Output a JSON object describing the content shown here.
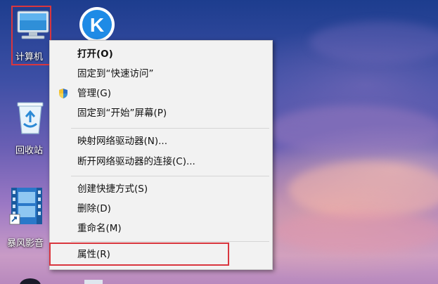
{
  "desktop": {
    "icons": [
      {
        "name": "computer",
        "label": "计算机",
        "icon": "computer-monitor-icon"
      },
      {
        "name": "kugou",
        "label": "",
        "icon": "kugou-k-icon"
      },
      {
        "name": "recycle-bin",
        "label": "回收站",
        "icon": "recycle-bin-icon"
      },
      {
        "name": "baofeng",
        "label": "暴风影音",
        "icon": "film-player-icon"
      }
    ]
  },
  "context_menu": {
    "items": [
      {
        "label": "打开(O)",
        "bold": true
      },
      {
        "label": "固定到“快速访问”"
      },
      {
        "label": "管理(G)",
        "icon": "uac-shield-icon"
      },
      {
        "label": "固定到“开始”屏幕(P)"
      },
      {
        "label": "映射网络驱动器(N)..."
      },
      {
        "label": "断开网络驱动器的连接(C)..."
      },
      {
        "label": "创建快捷方式(S)"
      },
      {
        "label": "删除(D)"
      },
      {
        "label": "重命名(M)"
      },
      {
        "label": "属性(R)",
        "highlighted": true
      }
    ]
  },
  "colors": {
    "highlight_border": "#d9363e",
    "menu_background": "#f2f2f2",
    "separator": "#d5d5d5"
  }
}
